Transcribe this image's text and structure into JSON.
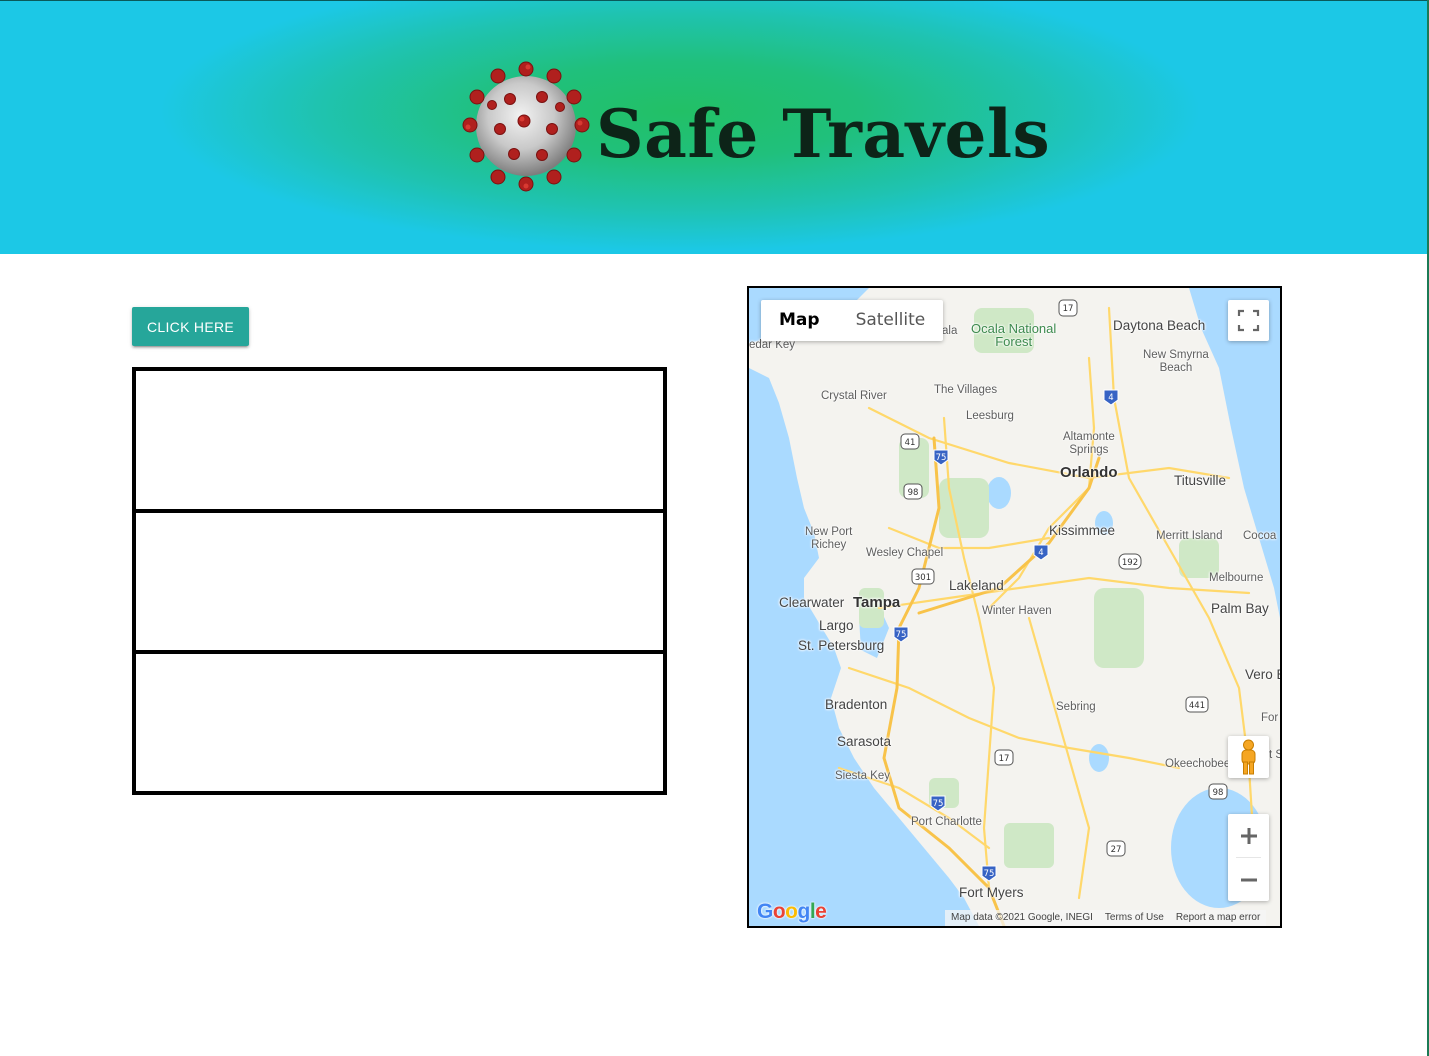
{
  "header": {
    "title": "Safe Travels",
    "logo_icon": "coronavirus-icon"
  },
  "actions": {
    "click_label": "CLICK HERE"
  },
  "result_boxes": [
    "",
    "",
    ""
  ],
  "map": {
    "type_options": [
      {
        "label": "Map",
        "active": true
      },
      {
        "label": "Satellite",
        "active": false
      }
    ],
    "places": [
      {
        "label": "Ocala National\nForest",
        "kind": "park"
      },
      {
        "label": "Daytona Beach",
        "kind": "mid"
      },
      {
        "label": "New Smyrna\nBeach",
        "kind": "small"
      },
      {
        "label": "edar Key",
        "kind": "small"
      },
      {
        "label": "ala",
        "kind": "small"
      },
      {
        "label": "The Villages",
        "kind": "small"
      },
      {
        "label": "Crystal River",
        "kind": "small"
      },
      {
        "label": "Leesburg",
        "kind": "small"
      },
      {
        "label": "Altamonte\nSprings",
        "kind": "small"
      },
      {
        "label": "Orlando",
        "kind": "big"
      },
      {
        "label": "Titusville",
        "kind": "mid"
      },
      {
        "label": "Kissimmee",
        "kind": "mid"
      },
      {
        "label": "New Port\nRichey",
        "kind": "small"
      },
      {
        "label": "Wesley Chapel",
        "kind": "small"
      },
      {
        "label": "Merritt Island",
        "kind": "small"
      },
      {
        "label": "Cocoa",
        "kind": "small"
      },
      {
        "label": "Lakeland",
        "kind": "mid"
      },
      {
        "label": "Melbourne",
        "kind": "small"
      },
      {
        "label": "Clearwater",
        "kind": "mid"
      },
      {
        "label": "Tampa",
        "kind": "big"
      },
      {
        "label": "Winter Haven",
        "kind": "small"
      },
      {
        "label": "Palm Bay",
        "kind": "mid"
      },
      {
        "label": "Largo",
        "kind": "mid"
      },
      {
        "label": "St. Petersburg",
        "kind": "mid"
      },
      {
        "label": "Vero B",
        "kind": "mid"
      },
      {
        "label": "Bradenton",
        "kind": "mid"
      },
      {
        "label": "Sebring",
        "kind": "small"
      },
      {
        "label": "For",
        "kind": "small"
      },
      {
        "label": "Sarasota",
        "kind": "mid"
      },
      {
        "label": "t S",
        "kind": "small"
      },
      {
        "label": "Siesta Key",
        "kind": "small"
      },
      {
        "label": "Okeechobee",
        "kind": "small"
      },
      {
        "label": "Port Charlotte",
        "kind": "small"
      },
      {
        "label": "Fort Myers",
        "kind": "mid"
      }
    ],
    "shields": [
      "17",
      "4",
      "41",
      "75",
      "98",
      "4",
      "192",
      "301",
      "75",
      "441",
      "17",
      "98",
      "75",
      "27",
      "75"
    ],
    "google_logo": "Google",
    "attribution": [
      "Map data ©2021 Google, INEGI",
      "Terms of Use",
      "Report a map error"
    ]
  }
}
